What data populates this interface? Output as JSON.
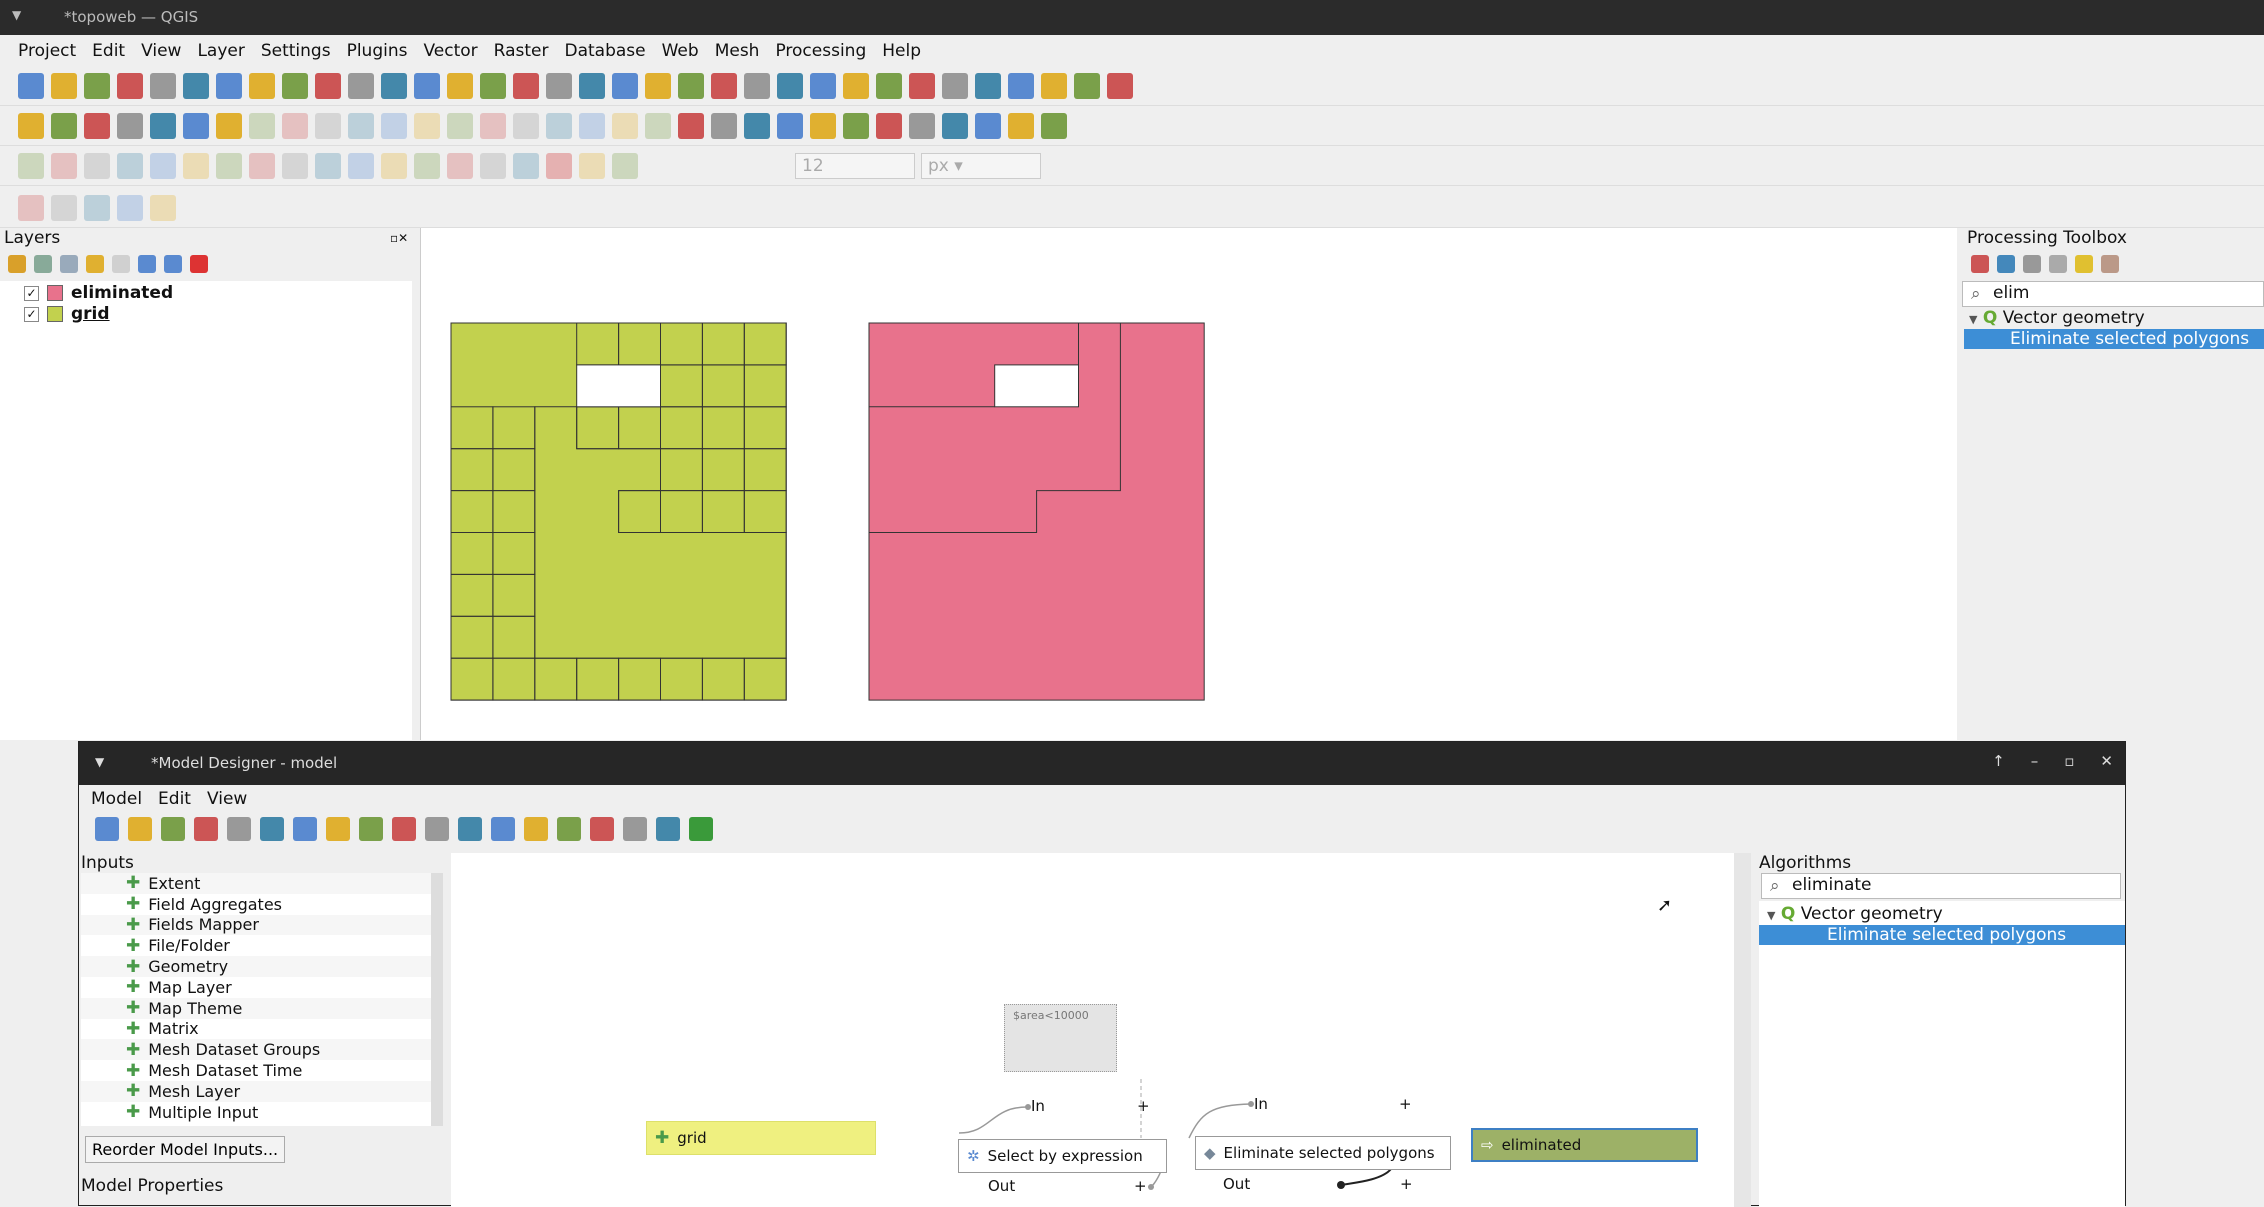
{
  "window": {
    "title": "*topoweb — QGIS",
    "menu_glyph": "▼"
  },
  "menubar": [
    "Project",
    "Edit",
    "View",
    "Layer",
    "Settings",
    "Plugins",
    "Vector",
    "Raster",
    "Database",
    "Web",
    "Mesh",
    "Processing",
    "Help"
  ],
  "toolbars": [
    [
      "new-project",
      "open-project",
      "save-project",
      "save-as",
      "print-layout",
      "style-manager",
      "pan-hand",
      "pan-to-selection",
      "zoom-in",
      "zoom-out",
      "zoom-full",
      "zoom-to-selection",
      "zoom-to-layer",
      "zoom-native",
      "zoom-last",
      "zoom-next",
      "new-map-view",
      "new-3d-view",
      "new-bookmark",
      "show-bookmarks",
      "temporal-controller",
      "refresh",
      "select-features",
      "select-by-expression",
      "deselect",
      "select-by-location",
      "identify",
      "attribute-table",
      "processing-toolbox",
      "statistics",
      "open-table",
      "measure",
      "map-tips",
      "filter"
    ],
    [
      "data-source-manager",
      "new-geopackage",
      "digitize-vertex",
      "georeferencer",
      "new-temp-layer",
      "raster-calc",
      "new-virtual-layer",
      "toggle-edit-pencil",
      "toggle-editing",
      "save-edits",
      "add-line",
      "add-feature",
      "vertex-tool",
      "modify-attributes",
      "delete-selected",
      "cut",
      "copy",
      "paste",
      "undo",
      "redo",
      "label-tool",
      "diagram-tool",
      "pin-labels",
      "highlight-labels",
      "move-label",
      "rotate-label",
      "change-label",
      "show-hide-labels",
      "db-manager",
      "globe",
      "python-console",
      "help"
    ],
    [
      "measure-angle",
      "add-ring",
      "add-part",
      "fill-ring",
      "delete-ring",
      "delete-part",
      "reshape",
      "offset-curve",
      "split-features",
      "split-parts",
      "merge-features",
      "merge-attributes",
      "rotate-point",
      "simplify",
      "rotate-feature",
      "vertex",
      "snap-magnet",
      "trace",
      "tolerance-toggle"
    ],
    [
      "shape-digitize",
      "circle",
      "ellipse",
      "rectangle",
      "polygon"
    ]
  ],
  "snapping": {
    "tolerance": "12",
    "unit": "px"
  },
  "layers": {
    "title": "Layers",
    "items": [
      {
        "name": "eliminated",
        "color": "#e8728c",
        "checked": "✓"
      },
      {
        "name": "grid",
        "color": "#c2d14e",
        "checked": "✓"
      }
    ]
  },
  "toolbox": {
    "title": "Processing Toolbox",
    "search": "elim",
    "group": "Vector geometry",
    "item": "Eliminate selected polygons"
  },
  "map": {
    "grid_color": "#c2d14e",
    "eliminated_color": "#e8728c"
  },
  "model_designer": {
    "title": "*Model Designer - model",
    "controls": [
      "↑",
      "–",
      "▫",
      "✕"
    ],
    "menu": [
      "Model",
      "Edit",
      "View"
    ],
    "tools": [
      "new",
      "open",
      "save",
      "save-as",
      "export-to-processing",
      "pan",
      "select",
      "undo",
      "redo",
      "zoom-in",
      "zoom-out",
      "zoom-actual",
      "zoom-full",
      "export-python",
      "export-image",
      "export-pdf",
      "export-svg",
      "help-edit",
      "run"
    ],
    "inputs_title": "Inputs",
    "inputs": [
      "Extent",
      "Field Aggregates",
      "Fields Mapper",
      "File/Folder",
      "Geometry",
      "Map Layer",
      "Map Theme",
      "Matrix",
      "Mesh Dataset Groups",
      "Mesh Dataset Time",
      "Mesh Layer",
      "Multiple Input"
    ],
    "reorder_button": "Reorder Model Inputs...",
    "model_properties": "Model Properties",
    "algorithms_title": "Algorithms",
    "alg_search": "eliminate",
    "alg_group": "Vector geometry",
    "alg_item": "Eliminate selected polygons",
    "nodes": {
      "grid": "grid",
      "comment": "$area<10000",
      "select": "Select by expression",
      "eliminate": "Eliminate selected polygons",
      "output": "eliminated",
      "in": "In",
      "out": "Out",
      "plus": "+"
    }
  }
}
